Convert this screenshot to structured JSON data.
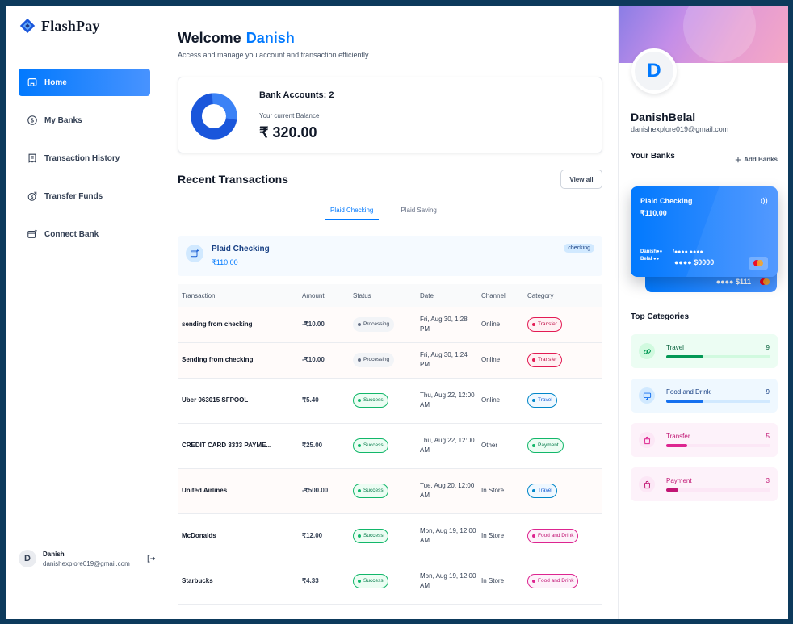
{
  "brand": {
    "name": "FlashPay"
  },
  "sidebar": {
    "items": [
      {
        "label": "Home",
        "icon": "home-icon"
      },
      {
        "label": "My Banks",
        "icon": "dollar-circle-icon"
      },
      {
        "label": "Transaction History",
        "icon": "receipt-icon"
      },
      {
        "label": "Transfer Funds",
        "icon": "money-send-icon"
      },
      {
        "label": "Connect Bank",
        "icon": "card-add-icon"
      }
    ],
    "footer": {
      "initial": "D",
      "name": "Danish",
      "email": "danishexplore019@gmail.com"
    }
  },
  "header": {
    "greeting": "Welcome",
    "user": "Danish",
    "subtitle": "Access and manage you account and transaction efficiently."
  },
  "balance": {
    "bank_accounts": "Bank Accounts: 2",
    "label": "Your current Balance",
    "value": "₹ 320.00"
  },
  "recent": {
    "title": "Recent Transactions",
    "view_all": "View all",
    "tabs": [
      "Plaid Checking",
      "Plaid Saving"
    ],
    "account": {
      "name": "Plaid Checking",
      "balance": "₹110.00",
      "type": "checking"
    },
    "columns": [
      "Transaction",
      "Amount",
      "Status",
      "Date",
      "Channel",
      "Category"
    ],
    "rows": [
      {
        "name": "sending from checking",
        "amount": "-₹10.00",
        "status": "Processing",
        "date": "Fri, Aug 30, 1:28 PM",
        "channel": "Online",
        "category": "Transfer"
      },
      {
        "name": "Sending from checking",
        "amount": "-₹10.00",
        "status": "Processing",
        "date": "Fri, Aug 30, 1:24 PM",
        "channel": "Online",
        "category": "Transfer"
      },
      {
        "name": "Uber 063015 SFPOOL",
        "amount": "₹5.40",
        "status": "Success",
        "date": "Thu, Aug 22, 12:00 AM",
        "channel": "Online",
        "category": "Travel"
      },
      {
        "name": "CREDIT CARD 3333 PAYME...",
        "amount": "₹25.00",
        "status": "Success",
        "date": "Thu, Aug 22, 12:00 AM",
        "channel": "Other",
        "category": "Payment"
      },
      {
        "name": "United Airlines",
        "amount": "-₹500.00",
        "status": "Success",
        "date": "Tue, Aug 20, 12:00 AM",
        "channel": "In Store",
        "category": "Travel"
      },
      {
        "name": "McDonalds",
        "amount": "₹12.00",
        "status": "Success",
        "date": "Mon, Aug 19, 12:00 AM",
        "channel": "In Store",
        "category": "Food and Drink"
      },
      {
        "name": "Starbucks",
        "amount": "₹4.33",
        "status": "Success",
        "date": "Mon, Aug 19, 12:00 AM",
        "channel": "In Store",
        "category": "Food and Drink"
      }
    ]
  },
  "profile": {
    "initial": "D",
    "name": "DanishBelal",
    "email": "danishexplore019@gmail.com"
  },
  "banks": {
    "title": "Your Banks",
    "add_label": "Add Banks",
    "card": {
      "name": "Plaid Checking",
      "balance": "₹110.00",
      "holder": "Danish●● Belal ●●",
      "masked": "/●●●● ●●●●",
      "number": "●●●● $0000",
      "expiry": "●●/●●"
    },
    "back_card_number": "●●●● $111"
  },
  "categories": {
    "title": "Top Categories",
    "items": [
      {
        "name": "Travel",
        "count": "9",
        "fill": 0.36,
        "icon": "link-icon",
        "bg": "#ecfdf3",
        "text": "#05603a",
        "bar": "#d1fadf",
        "fillcolor": "#039855",
        "icbg": "#d1fadf"
      },
      {
        "name": "Food and Drink",
        "count": "9",
        "fill": 0.36,
        "icon": "monitor-icon",
        "bg": "#eff8ff",
        "text": "#194185",
        "bar": "#d1e9ff",
        "fillcolor": "#1570ef",
        "icbg": "#d1e9ff"
      },
      {
        "name": "Transfer",
        "count": "5",
        "fill": 0.2,
        "icon": "bag-icon",
        "bg": "#fdf2fa",
        "text": "#c11574",
        "bar": "#fce7f6",
        "fillcolor": "#dd2590",
        "icbg": "#fce7f6"
      },
      {
        "name": "Payment",
        "count": "3",
        "fill": 0.12,
        "icon": "bag-icon",
        "bg": "#fdf2fa",
        "text": "#c11574",
        "bar": "#fce7f6",
        "fillcolor": "#c11574",
        "icbg": "#fce7f6"
      }
    ]
  },
  "colors": {
    "accent": "#0179fe",
    "ink": "#101828",
    "muted": "#475467"
  }
}
